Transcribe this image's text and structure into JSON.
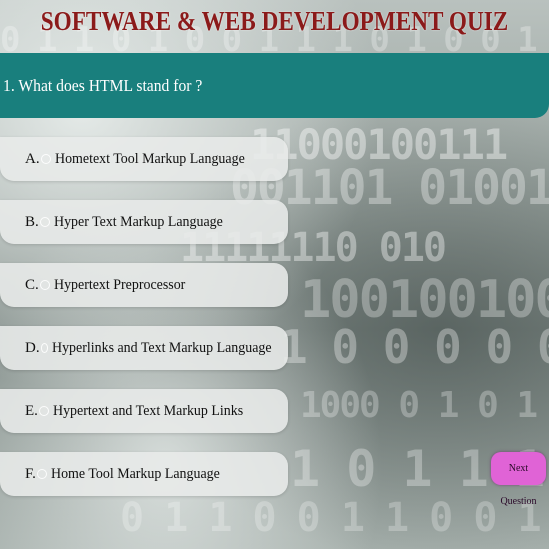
{
  "quiz": {
    "title": "SOFTWARE & WEB DEVELOPMENT QUIZ",
    "question": "1. What does HTML stand for ?",
    "options": [
      {
        "letter": "A.",
        "text": "Hometext Tool Markup Language"
      },
      {
        "letter": "B.",
        "text": "Hyper Text Markup Language"
      },
      {
        "letter": "C.",
        "text": "Hypertext Preprocessor"
      },
      {
        "letter": "D.",
        "text": "Hyperlinks and Text Markup Language"
      },
      {
        "letter": "E.",
        "text": "Hypertext and Text Markup Links"
      },
      {
        "letter": "F.",
        "text": "Home Tool Markup Language"
      }
    ],
    "next_label": "Next Question"
  },
  "colors": {
    "title": "#8b1a1a",
    "question_bar": "#197f7d",
    "next_button": "#e063d6"
  }
}
